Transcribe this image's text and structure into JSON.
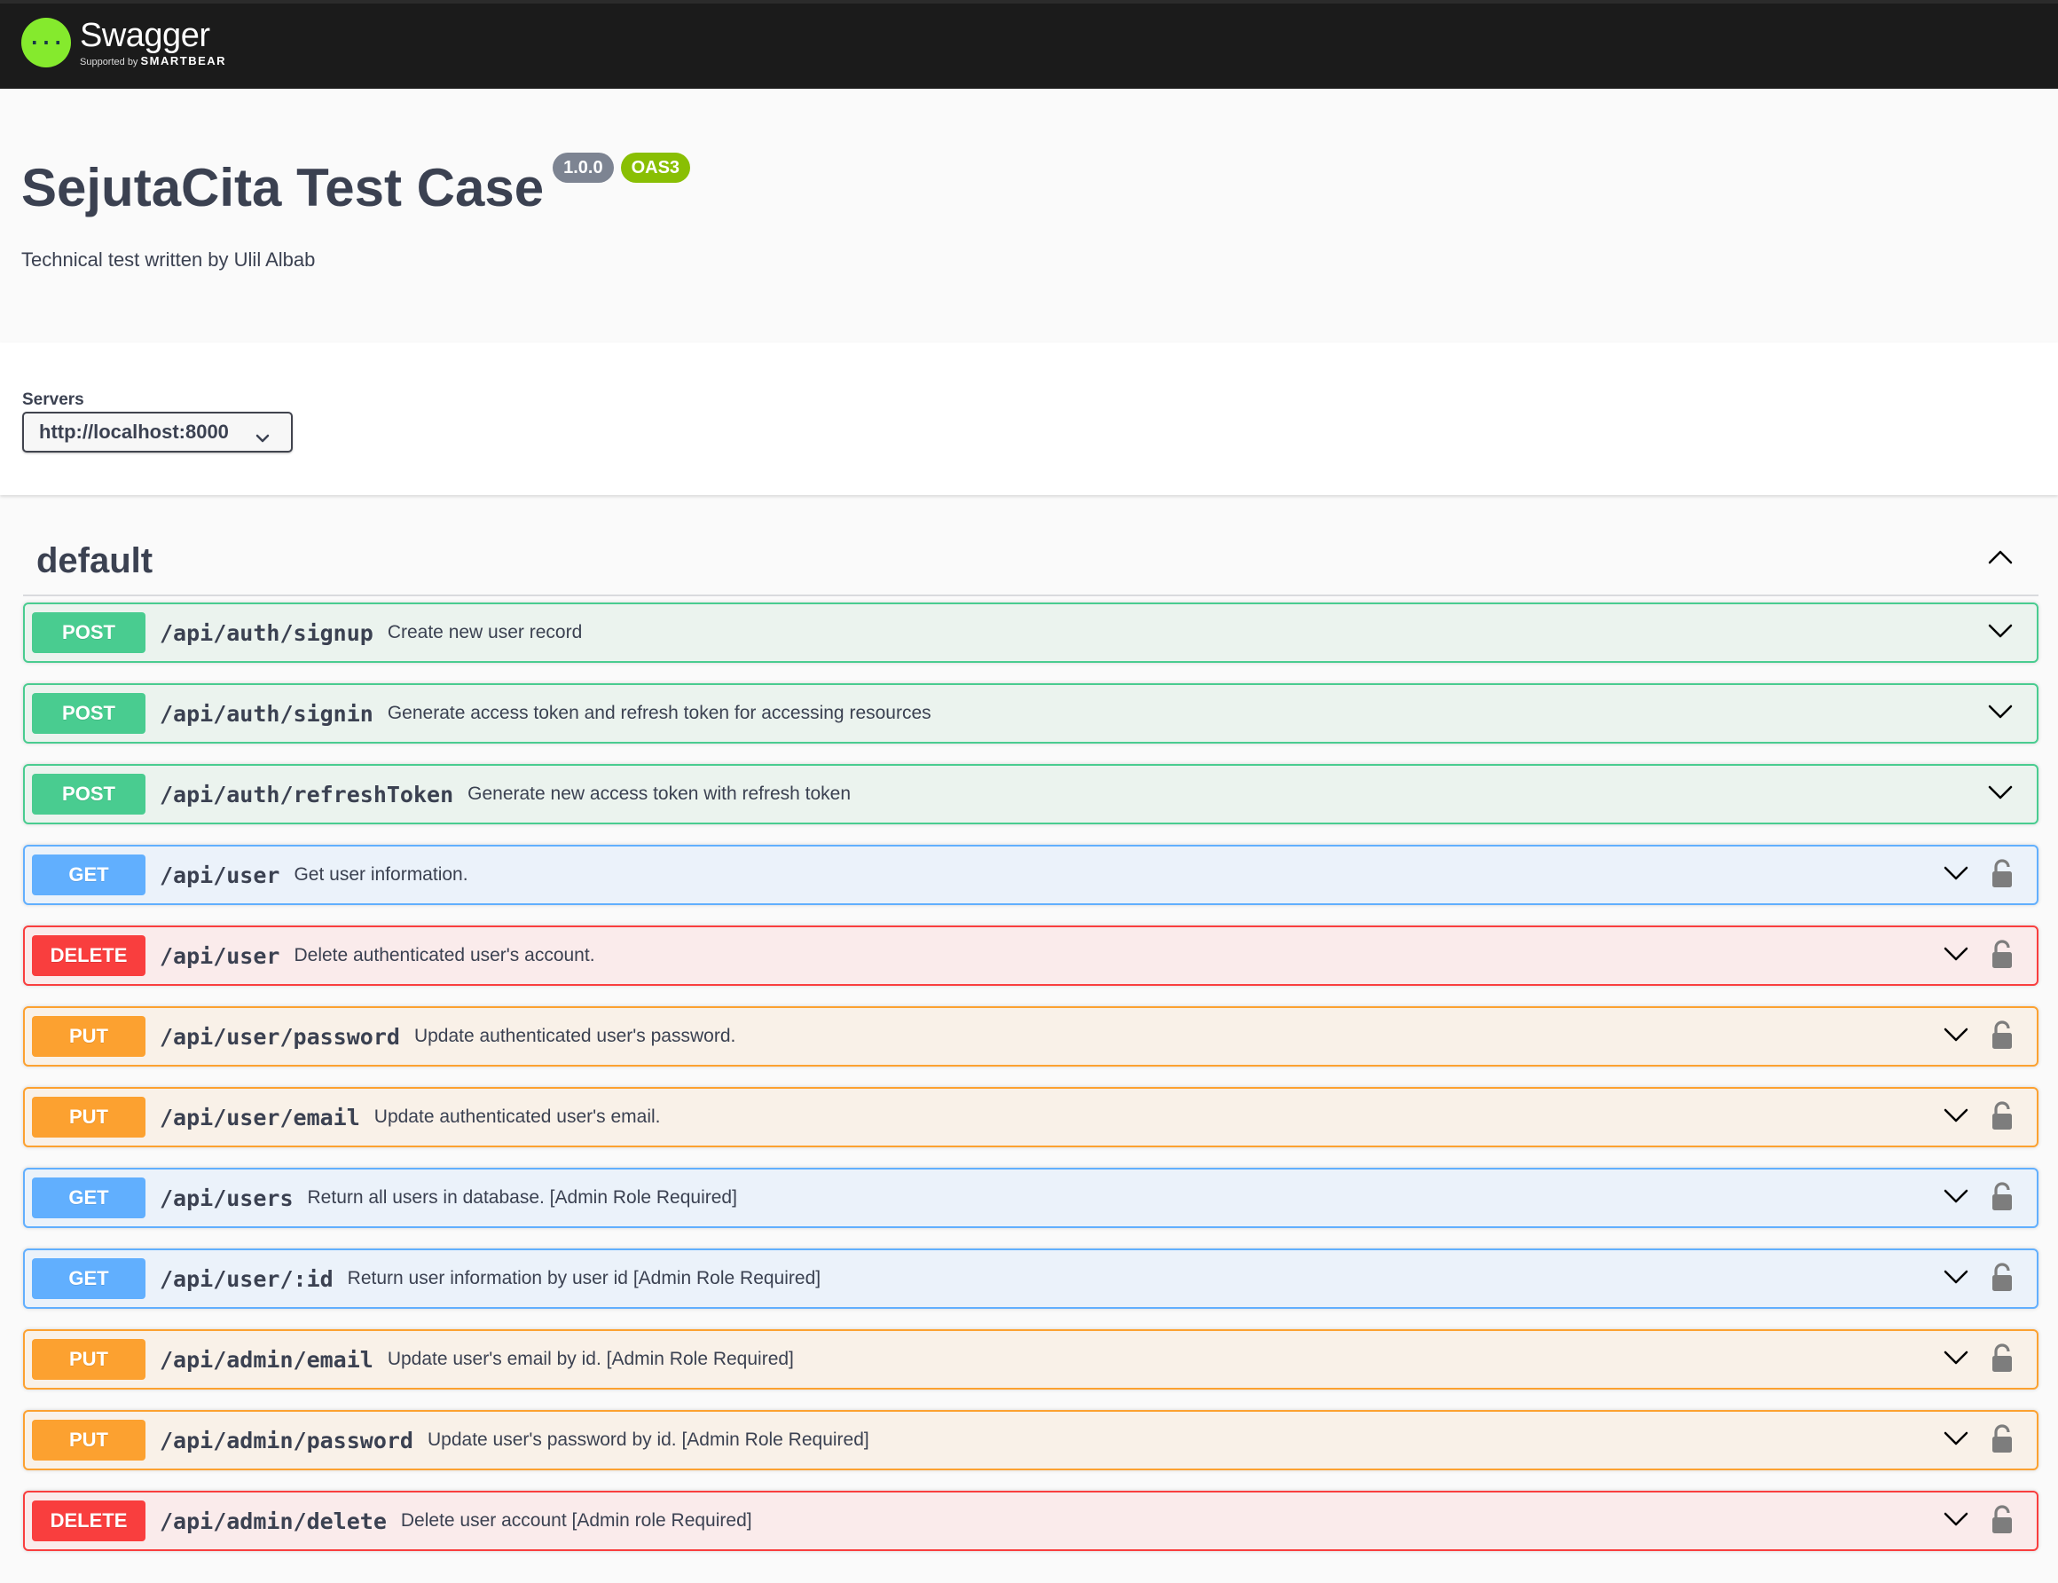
{
  "topbar": {
    "brand": "Swagger",
    "supported_prefix": "Supported by",
    "supported_brand": "SMARTBEAR",
    "logo_icon": "swagger-braces-icon"
  },
  "info": {
    "title": "SejutaCita Test Case",
    "version": "1.0.0",
    "oas_badge": "OAS3",
    "description": "Technical test written by Ulil Albab"
  },
  "servers": {
    "label": "Servers",
    "selected": "http://localhost:8000"
  },
  "tag": {
    "name": "default"
  },
  "operations": [
    {
      "method": "POST",
      "kind": "post",
      "path": "/api/auth/signup",
      "summary": "Create new user record",
      "locked": false
    },
    {
      "method": "POST",
      "kind": "post",
      "path": "/api/auth/signin",
      "summary": "Generate access token and refresh token for accessing resources",
      "locked": false
    },
    {
      "method": "POST",
      "kind": "post",
      "path": "/api/auth/refreshToken",
      "summary": "Generate new access token with refresh token",
      "locked": false
    },
    {
      "method": "GET",
      "kind": "get",
      "path": "/api/user",
      "summary": "Get user information.",
      "locked": true
    },
    {
      "method": "DELETE",
      "kind": "delete",
      "path": "/api/user",
      "summary": "Delete authenticated user's account.",
      "locked": true
    },
    {
      "method": "PUT",
      "kind": "put",
      "path": "/api/user/password",
      "summary": "Update authenticated user's password.",
      "locked": true
    },
    {
      "method": "PUT",
      "kind": "put",
      "path": "/api/user/email",
      "summary": "Update authenticated user's email.",
      "locked": true
    },
    {
      "method": "GET",
      "kind": "get",
      "path": "/api/users",
      "summary": "Return all users in database. [Admin Role Required]",
      "locked": true
    },
    {
      "method": "GET",
      "kind": "get",
      "path": "/api/user/:id",
      "summary": "Return user information by user id [Admin Role Required]",
      "locked": true
    },
    {
      "method": "PUT",
      "kind": "put",
      "path": "/api/admin/email",
      "summary": "Update user's email by id. [Admin Role Required]",
      "locked": true
    },
    {
      "method": "PUT",
      "kind": "put",
      "path": "/api/admin/password",
      "summary": "Update user's password by id. [Admin Role Required]",
      "locked": true
    },
    {
      "method": "DELETE",
      "kind": "delete",
      "path": "/api/admin/delete",
      "summary": "Delete user account [Admin role Required]",
      "locked": true
    }
  ],
  "colors": {
    "post": "#49cc90",
    "get": "#61affe",
    "delete": "#f93e3e",
    "put": "#fca130",
    "swagger_green": "#85ea2d",
    "topbar": "#1b1b1b"
  }
}
